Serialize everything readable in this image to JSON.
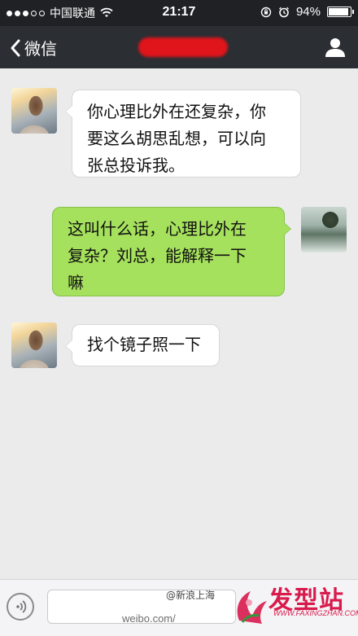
{
  "status_bar": {
    "carrier": "中国联通",
    "time": "21:17",
    "battery_percent": "94%",
    "battery_level": 0.94,
    "signal_dots_filled": 3,
    "signal_dots_total": 5
  },
  "nav": {
    "back_label": "微信",
    "title": "",
    "back_icon": "chevron-left-icon",
    "profile_icon": "person-icon"
  },
  "messages": [
    {
      "direction": "in",
      "avatar": "girl",
      "text": "你心理比外在还复杂，你\n要这么胡思乱想，可以向\n张总投诉我。"
    },
    {
      "direction": "out",
      "avatar": "landscape",
      "text": "这叫什么话，心理比外在\n复杂？刘总，能解释一下\n嘛"
    },
    {
      "direction": "in",
      "avatar": "girl",
      "text": "找个镜子照一下"
    }
  ],
  "input_bar": {
    "voice_icon": "voice-icon",
    "text_value": ""
  },
  "watermarks": {
    "weibo_url": "weibo.com/",
    "sina": "@新浪上海",
    "logo_text": "发型站",
    "logo_url": "WWW.FAXINGZHAN.COM"
  },
  "colors": {
    "status_bg": "#1f2124",
    "nav_bg": "#2b2e33",
    "chat_bg": "#ebebeb",
    "bubble_out": "#a5e15c",
    "bubble_in": "#ffffff",
    "title_redaction": "#e0141b",
    "logo": "#d81a4c"
  }
}
